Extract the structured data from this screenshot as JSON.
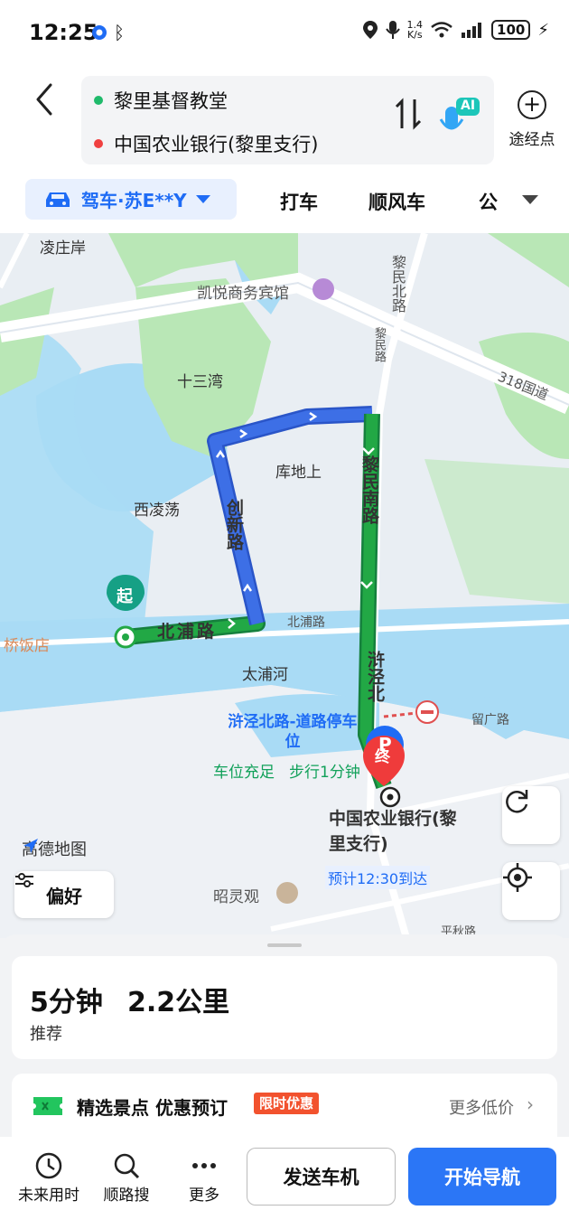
{
  "status_bar": {
    "time": "12:25",
    "speed_top": "1.4",
    "speed_unit": "K/s",
    "battery": "100",
    "icons": [
      "notification-icon",
      "bluetooth-icon",
      "location-icon",
      "mic-icon",
      "wifi-icon",
      "signal-icon",
      "charging-icon"
    ]
  },
  "route": {
    "origin": "黎里基督教堂",
    "destination": "中国农业银行(黎里支行)",
    "origin_color": "#1fba6b",
    "destination_color": "#f04040",
    "ai_label": "AI",
    "waypoint_label": "途经点"
  },
  "modes": {
    "active": "驾车·苏E**Y",
    "tabs": [
      "打车",
      "顺风车",
      "公"
    ]
  },
  "map": {
    "labels": {
      "lingzhuang": "凌庄岸",
      "hotel": "凯悦商务宾馆",
      "shisanwan": "十三湾",
      "kudishang": "库地上",
      "xilingdang": "西凌荡",
      "restaurant": "桥饭店",
      "taipu_river": "太浦河",
      "beipu_road_small": "北浦路",
      "liuguang_road": "留广路",
      "zhaolingguan": "昭灵观",
      "road_318": "318国道",
      "limin_north": "黎民北路",
      "limin_small": "黎民路",
      "pingze_road_bottom": "平秋路"
    },
    "route_labels": {
      "chuangxin": "创新路",
      "beipu": "北浦路",
      "limin_south": "黎民南路",
      "pingze_north": "浒泾北"
    },
    "start_marker": "起",
    "end_marker": "终",
    "parking": {
      "name": "浒泾北路-道路停车位",
      "status": "车位充足",
      "walk": "步行1分钟",
      "icon": "P"
    },
    "destination_label": "中国农业银行(黎里支行)",
    "eta": "预计12:30到达",
    "brand": "高德地图",
    "preference_label": "偏好",
    "route_colors": {
      "fast": "#22a845",
      "slow": "#3d6fe6"
    }
  },
  "summary": {
    "time": "5分钟",
    "distance": "2.2公里",
    "tag": "推荐"
  },
  "promo": {
    "title": "精选景点 优惠预订",
    "badge": "限时优惠",
    "more": "更多低价"
  },
  "bottom_bar": {
    "future": "未来用时",
    "search_along": "顺路搜",
    "more": "更多",
    "send_to_car": "发送车机",
    "start_nav": "开始导航"
  }
}
